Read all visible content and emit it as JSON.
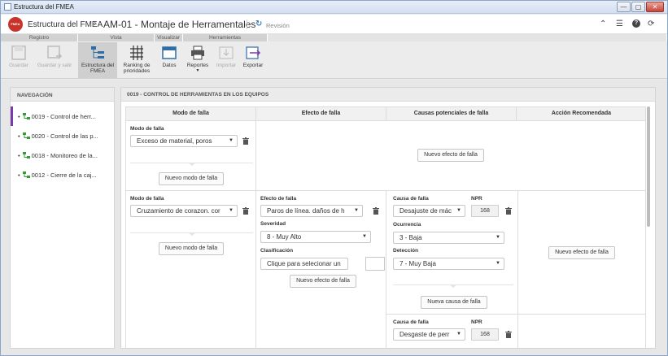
{
  "window": {
    "title": "Estructura del FMEA",
    "btn_min": "—",
    "btn_max": "▢",
    "btn_close": "✕"
  },
  "header": {
    "breadcrumb_root": "Estructura del FMEA",
    "separator": "›",
    "current": "AM-01 - Montaje de Herramentales",
    "revision": "Revisión"
  },
  "ribbon": {
    "groups": [
      "Registro",
      "Vista",
      "Visualizar",
      "Herramientas"
    ],
    "buttons": {
      "guardar": "Guardar",
      "guardar_salir": "Guardar y salir",
      "estructura": "Estructura del FMEA",
      "ranking": "Ranking de prioridades",
      "datos": "Datos",
      "reportes": "Reportes",
      "importar": "Importar",
      "exportar": "Exportar"
    }
  },
  "navigation": {
    "title": "NAVEGACIÓN",
    "items": [
      {
        "label": "0019 - Control de herr..."
      },
      {
        "label": "0020 - Control de las p..."
      },
      {
        "label": "0018 - Monitoreo de la..."
      },
      {
        "label": "0012 - Cierre de la caj..."
      }
    ]
  },
  "panel": {
    "title": "0019 - CONTROL DE HERRAMIENTAS EN LOS EQUIPOS",
    "columns": [
      "Modo de falla",
      "Efecto de falla",
      "Causas potenciales de falla",
      "Acción Recomendada"
    ],
    "row1": {
      "mode_label": "Modo de falla",
      "mode_value": "Exceso de material, poros",
      "new_mode": "Nuevo modo de falla",
      "new_effect": "Nuevo efecto de falla"
    },
    "row2": {
      "mode_label": "Modo de falla",
      "mode_value": "Cruzamiento de corazon. cor",
      "new_mode": "Nuevo modo de falla",
      "effect_label": "Efecto de falla",
      "effect_value": "Paros de línea. daños de h",
      "severity_label": "Severidad",
      "severity_value": "8 - Muy Alto",
      "class_label": "Clasificación",
      "class_value": "Clique para selecionar un",
      "new_effect": "Nuevo efecto de falla",
      "cause1": {
        "label": "Causa de falla",
        "value": "Desajuste de mác",
        "npr_label": "NPR",
        "npr": "168"
      },
      "occ_label": "Ocurrencia",
      "occ_value": "3 - Baja",
      "det_label": "Detección",
      "det_value": "7 - Muy Baja",
      "new_cause": "Nueva causa de falla",
      "cause2": {
        "label": "Causa de falla",
        "value": "Desgaste de perr",
        "npr_label": "NPR",
        "npr": "168"
      },
      "new_effect_action": "Nuevo efecto de falla"
    }
  }
}
